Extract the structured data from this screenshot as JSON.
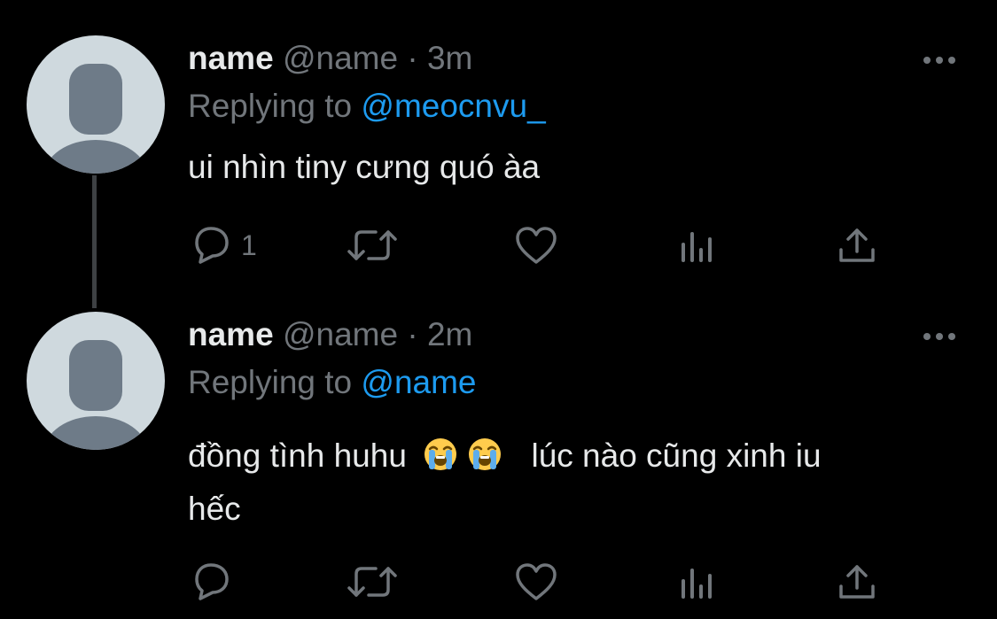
{
  "tweets": [
    {
      "display_name": "name",
      "handle": "@name",
      "separator": "·",
      "time": "3m",
      "replying_label": "Replying to",
      "replying_to": "@meocnvu_",
      "text": "ui nhìn tiny cưng quó àa",
      "reply_count": "1"
    },
    {
      "display_name": "name",
      "handle": "@name",
      "separator": "·",
      "time": "2m",
      "replying_label": "Replying to",
      "replying_to": "@name",
      "text_part1": "đồng tình huhu",
      "text_part2": "lúc nào cũng xinh iu",
      "text_line2": "hếc",
      "reply_count": ""
    }
  ],
  "icons": {
    "avatar": "default-avatar-icon",
    "more": "more-horizontal-icon",
    "reply": "reply-icon",
    "retweet": "retweet-icon",
    "like": "heart-icon",
    "views": "analytics-icon",
    "share": "share-icon",
    "emoji": "loudly-crying-face-emoji"
  },
  "colors": {
    "background": "#000000",
    "text": "#E7E9EA",
    "secondary": "#71767B",
    "link": "#1D9BF0",
    "avatar_bg": "#CFD9DE",
    "avatar_figure": "#6E7B88"
  }
}
